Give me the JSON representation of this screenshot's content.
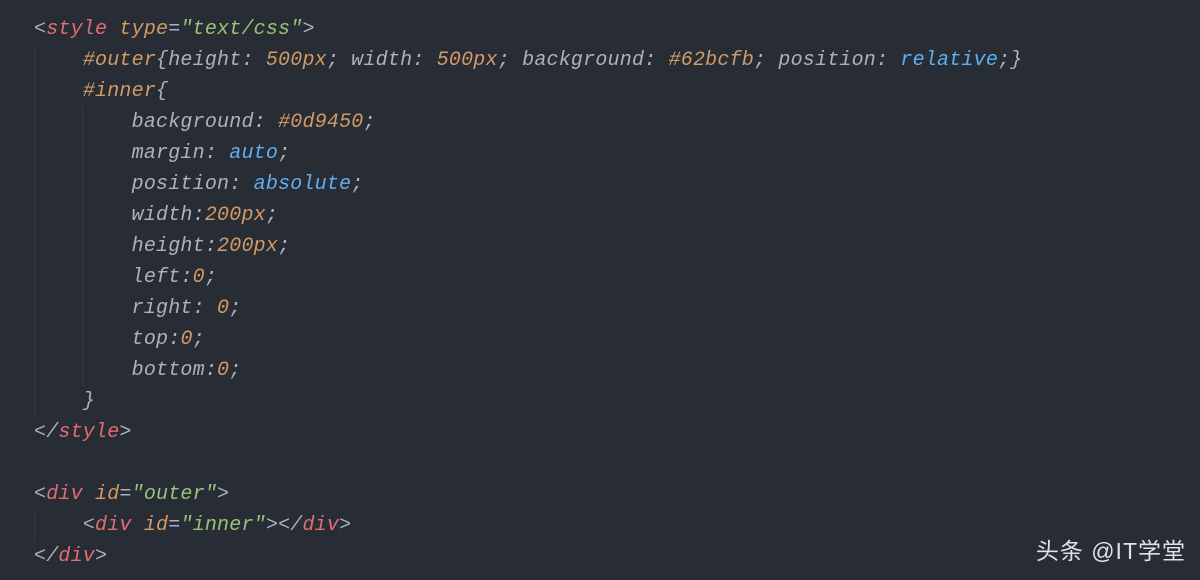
{
  "code": {
    "indent1": "    ",
    "indent2": "        ",
    "style_open": {
      "lt": "<",
      "tag": "style",
      "sp": " ",
      "attr": "type",
      "eq": "=",
      "val": "\"text/css\"",
      "gt": ">"
    },
    "outer_line": {
      "sel": "#outer",
      "ob": "{",
      "p1": "height",
      "c1": ": ",
      "v1": "500px",
      "sc": "; ",
      "p2": "width",
      "v2": "500px",
      "p3": "background",
      "v3": "#62bcfb",
      "p4": "position",
      "v4": "relative",
      "sc_end": ";",
      "cb": "}"
    },
    "inner_open": {
      "sel": "#inner",
      "ob": "{"
    },
    "decls": {
      "bg": {
        "p": "background",
        "c": ": ",
        "v": "#0d9450",
        "sc": ";"
      },
      "margin": {
        "p": "margin",
        "c": ": ",
        "v": "auto",
        "sc": ";"
      },
      "pos": {
        "p": "position",
        "c": ": ",
        "v": "absolute",
        "sc": ";"
      },
      "w": {
        "p": "width",
        "c": ":",
        "v": "200px",
        "sc": ";"
      },
      "h": {
        "p": "height",
        "c": ":",
        "v": "200px",
        "sc": ";"
      },
      "l": {
        "p": "left",
        "c": ":",
        "v": "0",
        "sc": ";"
      },
      "r": {
        "p": "right",
        "c": ": ",
        "v": "0",
        "sc": ";"
      },
      "t": {
        "p": "top",
        "c": ":",
        "v": "0",
        "sc": ";"
      },
      "b": {
        "p": "bottom",
        "c": ":",
        "v": "0",
        "sc": ";"
      }
    },
    "inner_close": "}",
    "style_close": {
      "lt": "</",
      "tag": "style",
      "gt": ">"
    },
    "blank": " ",
    "div_outer_open": {
      "lt": "<",
      "tag": "div",
      "sp": " ",
      "attr": "id",
      "eq": "=",
      "val": "\"outer\"",
      "gt": ">"
    },
    "div_inner": {
      "lt": "<",
      "tag": "div",
      "sp": " ",
      "attr": "id",
      "eq": "=",
      "val": "\"inner\"",
      "gt": ">",
      "lt2": "</",
      "tag2": "div",
      "gt2": ">"
    },
    "div_outer_close": {
      "lt": "</",
      "tag": "div",
      "gt": ">"
    }
  },
  "watermark": "头条 @IT学堂"
}
